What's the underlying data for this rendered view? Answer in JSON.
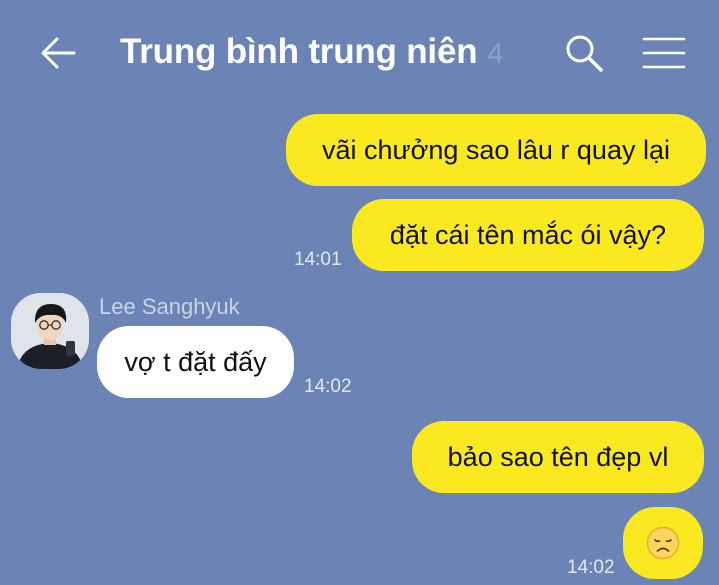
{
  "header": {
    "title": "Trung bình trung niên",
    "member_count": "4",
    "back_icon": "arrow-left-icon",
    "search_icon": "search-icon",
    "menu_icon": "hamburger-menu-icon"
  },
  "colors": {
    "background": "#6b84b5",
    "outgoing_bubble": "#fae920",
    "incoming_bubble": "#ffffff"
  },
  "messages": [
    {
      "direction": "outgoing",
      "text": "vãi chưởng sao lâu r quay lại"
    },
    {
      "direction": "outgoing",
      "text": "đặt cái tên mắc ói vậy?",
      "time": "14:01"
    },
    {
      "direction": "incoming",
      "sender": "Lee Sanghyuk",
      "text": "vợ t đặt đấy",
      "time": "14:02"
    },
    {
      "direction": "outgoing",
      "text": "bảo sao tên đẹp vl"
    },
    {
      "direction": "outgoing",
      "emoji": "disappointed-face-emoji",
      "time": "14:02"
    }
  ]
}
